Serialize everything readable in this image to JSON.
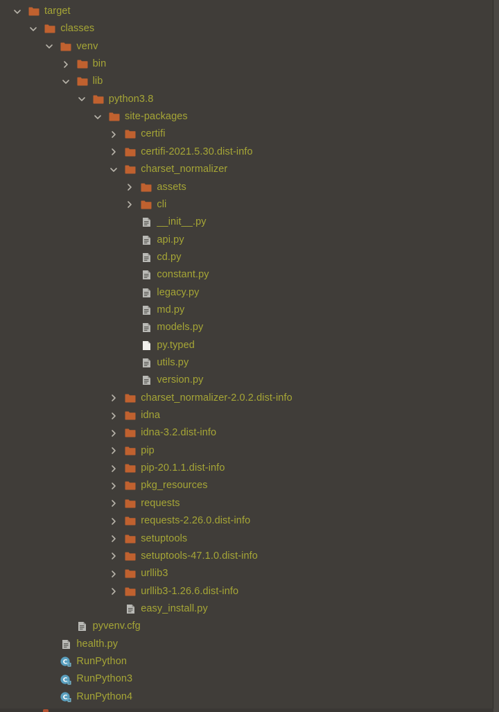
{
  "colors": {
    "background": "#403d39",
    "text": "#a6a636",
    "folder": "#c0612f",
    "chevron": "#b8b4aa",
    "file": "#b9b9b5",
    "typed_file": "#f1f0ec",
    "class_icon": "#5a9fbe"
  },
  "tree": [
    {
      "label": "target",
      "depth": 0,
      "kind": "folder",
      "expanded": true
    },
    {
      "label": "classes",
      "depth": 1,
      "kind": "folder",
      "expanded": true
    },
    {
      "label": "venv",
      "depth": 2,
      "kind": "folder",
      "expanded": true
    },
    {
      "label": "bin",
      "depth": 3,
      "kind": "folder",
      "expanded": false
    },
    {
      "label": "lib",
      "depth": 3,
      "kind": "folder",
      "expanded": true
    },
    {
      "label": "python3.8",
      "depth": 4,
      "kind": "folder",
      "expanded": true
    },
    {
      "label": "site-packages",
      "depth": 5,
      "kind": "folder",
      "expanded": true
    },
    {
      "label": "certifi",
      "depth": 6,
      "kind": "folder",
      "expanded": false
    },
    {
      "label": "certifi-2021.5.30.dist-info",
      "depth": 6,
      "kind": "folder",
      "expanded": false
    },
    {
      "label": "charset_normalizer",
      "depth": 6,
      "kind": "folder",
      "expanded": true
    },
    {
      "label": "assets",
      "depth": 7,
      "kind": "folder",
      "expanded": false
    },
    {
      "label": "cli",
      "depth": 7,
      "kind": "folder",
      "expanded": false
    },
    {
      "label": "__init__.py",
      "depth": 7,
      "kind": "file"
    },
    {
      "label": "api.py",
      "depth": 7,
      "kind": "file"
    },
    {
      "label": "cd.py",
      "depth": 7,
      "kind": "file"
    },
    {
      "label": "constant.py",
      "depth": 7,
      "kind": "file"
    },
    {
      "label": "legacy.py",
      "depth": 7,
      "kind": "file"
    },
    {
      "label": "md.py",
      "depth": 7,
      "kind": "file"
    },
    {
      "label": "models.py",
      "depth": 7,
      "kind": "file"
    },
    {
      "label": "py.typed",
      "depth": 7,
      "kind": "typed"
    },
    {
      "label": "utils.py",
      "depth": 7,
      "kind": "file"
    },
    {
      "label": "version.py",
      "depth": 7,
      "kind": "file"
    },
    {
      "label": "charset_normalizer-2.0.2.dist-info",
      "depth": 6,
      "kind": "folder",
      "expanded": false
    },
    {
      "label": "idna",
      "depth": 6,
      "kind": "folder",
      "expanded": false
    },
    {
      "label": "idna-3.2.dist-info",
      "depth": 6,
      "kind": "folder",
      "expanded": false
    },
    {
      "label": "pip",
      "depth": 6,
      "kind": "folder",
      "expanded": false
    },
    {
      "label": "pip-20.1.1.dist-info",
      "depth": 6,
      "kind": "folder",
      "expanded": false
    },
    {
      "label": "pkg_resources",
      "depth": 6,
      "kind": "folder",
      "expanded": false
    },
    {
      "label": "requests",
      "depth": 6,
      "kind": "folder",
      "expanded": false
    },
    {
      "label": "requests-2.26.0.dist-info",
      "depth": 6,
      "kind": "folder",
      "expanded": false
    },
    {
      "label": "setuptools",
      "depth": 6,
      "kind": "folder",
      "expanded": false
    },
    {
      "label": "setuptools-47.1.0.dist-info",
      "depth": 6,
      "kind": "folder",
      "expanded": false
    },
    {
      "label": "urllib3",
      "depth": 6,
      "kind": "folder",
      "expanded": false
    },
    {
      "label": "urllib3-1.26.6.dist-info",
      "depth": 6,
      "kind": "folder",
      "expanded": false
    },
    {
      "label": "easy_install.py",
      "depth": 6,
      "kind": "file"
    },
    {
      "label": "pyvenv.cfg",
      "depth": 3,
      "kind": "file"
    },
    {
      "label": "health.py",
      "depth": 2,
      "kind": "file"
    },
    {
      "label": "RunPython",
      "depth": 2,
      "kind": "class"
    },
    {
      "label": "RunPython3",
      "depth": 2,
      "kind": "class"
    },
    {
      "label": "RunPython4",
      "depth": 2,
      "kind": "class"
    }
  ]
}
